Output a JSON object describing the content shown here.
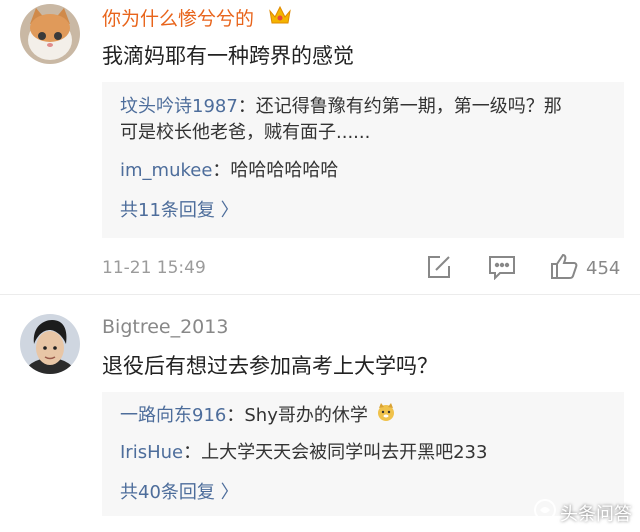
{
  "comments": [
    {
      "username": "你为什么惨兮兮的",
      "badge": "crown-badge",
      "text": "我滴妈耶有一种跨界的感觉",
      "replies": [
        {
          "user": "坟头吟诗1987",
          "text": "：还记得鲁豫有约第一期，第一级吗？那"
        },
        {
          "user": "",
          "text": "可是校长他老爸，贼有面子......"
        },
        {
          "user": "im_mukee",
          "text": "：哈哈哈哈哈哈"
        }
      ],
      "more": "共11条回复 〉",
      "time": "11-21 15:49",
      "likes": "454"
    },
    {
      "username": "Bigtree_2013",
      "text": "退役后有想过去参加高考上大学吗？",
      "replies": [
        {
          "user": "一路向东916",
          "text": "：Shy哥办的休学"
        },
        {
          "user": "IrisHue",
          "text": "：上大学天天会被同学叫去开黑吧233"
        }
      ],
      "more": "共40条回复 〉"
    }
  ],
  "watermark": "头条问答",
  "colors": {
    "username_orange": "#e8641b",
    "username_gray": "#888888",
    "link_blue": "#4d6d9b",
    "reply_bg": "#f7f7f7"
  }
}
